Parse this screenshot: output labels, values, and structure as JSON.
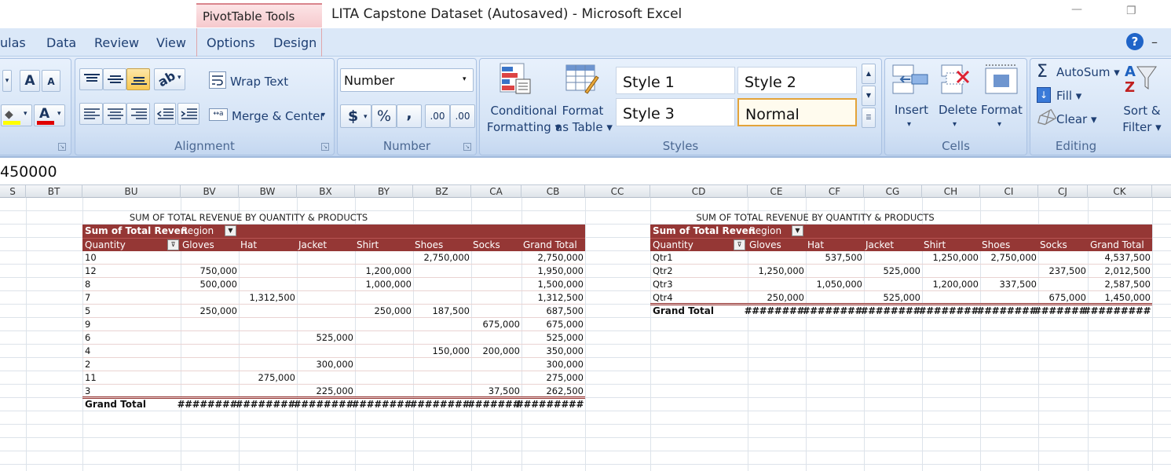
{
  "window": {
    "context_tab": "PivotTable Tools",
    "title": "LITA Capstone Dataset (Autosaved) - Microsoft Excel",
    "min_glyph": "—",
    "restore_glyph": "❐"
  },
  "tabs": {
    "formulas": "ulas",
    "data": "Data",
    "review": "Review",
    "view": "View",
    "options": "Options",
    "design": "Design",
    "help": "?",
    "minimize": "–"
  },
  "ribbon": {
    "font": {
      "grow": "A",
      "shrink": "A",
      "fill_arrow": "▾",
      "font_color": "A"
    },
    "alignment": {
      "label": "Alignment",
      "wrap_text": "Wrap Text",
      "merge_center": "Merge & Center",
      "merge_arrow": "▾"
    },
    "number": {
      "label": "Number",
      "format_value": "Number",
      "currency": "$",
      "percent": "%",
      "comma": ",",
      "increase_decimal": ".00",
      "decrease_decimal": ".00",
      "dd_arrow": "▾"
    },
    "styles": {
      "label": "Styles",
      "conditional_formatting": [
        "Conditional",
        "Formatting ▾"
      ],
      "format_as_table": [
        "Format",
        "as Table ▾"
      ],
      "gallery": [
        "Style 1",
        "Style 2",
        "Style 3",
        "Normal"
      ]
    },
    "cells": {
      "label": "Cells",
      "insert": "Insert",
      "delete": "Delete",
      "format": "Format",
      "arrow": "▾"
    },
    "editing": {
      "label": "Editing",
      "autosum": "AutoSum ▾",
      "fill": "Fill ▾",
      "clear": "Clear ▾",
      "sort_filter": [
        "Sort &",
        "Filter ▾"
      ],
      "sigma": "Σ"
    }
  },
  "formula_bar": {
    "value": "450000"
  },
  "columns": [
    "S",
    "BT",
    "BU",
    "BV",
    "BW",
    "BX",
    "BY",
    "BZ",
    "CA",
    "CB",
    "CC",
    "CD",
    "CE",
    "CF",
    "CG",
    "CH",
    "CI",
    "CJ",
    "CK"
  ],
  "pivot1": {
    "title": "SUM OF TOTAL REVENUE BY QUANTITY & PRODUCTS",
    "measure": "Sum of Total Reven",
    "col_field": "Region",
    "row_field": "Quantity",
    "headers": [
      "Gloves",
      "Hat",
      "Jacket",
      "Shirt",
      "Shoes",
      "Socks",
      "Grand Total"
    ],
    "rows": [
      {
        "label": "10",
        "values": [
          "",
          "",
          "",
          "",
          "2,750,000",
          "",
          "2,750,000"
        ]
      },
      {
        "label": "12",
        "values": [
          "750,000",
          "",
          "",
          "1,200,000",
          "",
          "",
          "1,950,000"
        ]
      },
      {
        "label": "8",
        "values": [
          "500,000",
          "",
          "",
          "1,000,000",
          "",
          "",
          "1,500,000"
        ]
      },
      {
        "label": "7",
        "values": [
          "",
          "1,312,500",
          "",
          "",
          "",
          "",
          "1,312,500"
        ]
      },
      {
        "label": "5",
        "values": [
          "250,000",
          "",
          "",
          "250,000",
          "187,500",
          "",
          "687,500"
        ]
      },
      {
        "label": "9",
        "values": [
          "",
          "",
          "",
          "",
          "",
          "675,000",
          "675,000"
        ]
      },
      {
        "label": "6",
        "values": [
          "",
          "",
          "525,000",
          "",
          "",
          "",
          "525,000"
        ]
      },
      {
        "label": "4",
        "values": [
          "",
          "",
          "",
          "",
          "150,000",
          "200,000",
          "350,000"
        ]
      },
      {
        "label": "2",
        "values": [
          "",
          "",
          "300,000",
          "",
          "",
          "",
          "300,000"
        ]
      },
      {
        "label": "11",
        "values": [
          "",
          "275,000",
          "",
          "",
          "",
          "",
          "275,000"
        ]
      },
      {
        "label": "3",
        "values": [
          "",
          "",
          "225,000",
          "",
          "",
          "37,500",
          "262,500"
        ]
      }
    ],
    "grand_total": {
      "label": "Grand Total",
      "values": [
        "########",
        "########",
        "########",
        "########",
        "########",
        "#######",
        "#########"
      ]
    }
  },
  "pivot2": {
    "title": "SUM OF TOTAL REVENUE BY QUANTITY & PRODUCTS",
    "measure": "Sum of Total Reven",
    "col_field": "Region",
    "row_field": "Quantity",
    "headers": [
      "Gloves",
      "Hat",
      "Jacket",
      "Shirt",
      "Shoes",
      "Socks",
      "Grand Total"
    ],
    "rows": [
      {
        "label": "Qtr1",
        "values": [
          "",
          "537,500",
          "",
          "1,250,000",
          "2,750,000",
          "",
          "4,537,500"
        ]
      },
      {
        "label": "Qtr2",
        "values": [
          "1,250,000",
          "",
          "525,000",
          "",
          "",
          "237,500",
          "2,012,500"
        ]
      },
      {
        "label": "Qtr3",
        "values": [
          "",
          "1,050,000",
          "",
          "1,200,000",
          "337,500",
          "",
          "2,587,500"
        ]
      },
      {
        "label": "Qtr4",
        "values": [
          "250,000",
          "",
          "525,000",
          "",
          "",
          "675,000",
          "1,450,000"
        ]
      }
    ],
    "grand_total": {
      "label": "Grand Total",
      "values": [
        "########",
        "########",
        "########",
        "########",
        "########",
        "#######",
        "#########"
      ]
    }
  },
  "colors": {
    "pivot_header": "#953735",
    "ribbon": "#dbe8f8",
    "context_tab": "#f6c9cd"
  }
}
